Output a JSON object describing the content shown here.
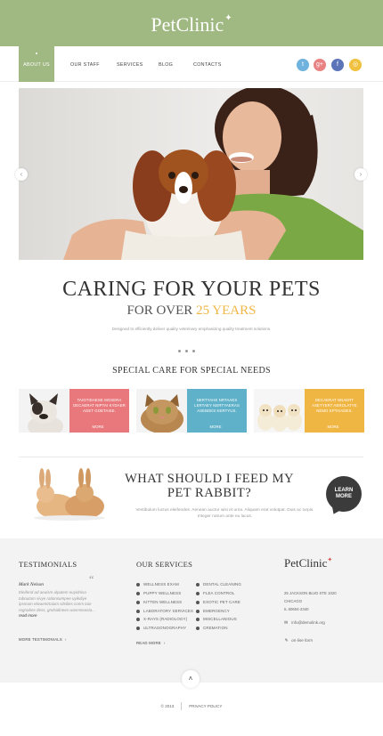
{
  "brand": {
    "logo_text": "PetClinic",
    "logo_mark": "✦",
    "accent": "#a0b982",
    "highlight": "#f0b643"
  },
  "nav": {
    "items": [
      {
        "label": "About us",
        "active": true
      },
      {
        "label": "Our staff",
        "active": false
      },
      {
        "label": "Services",
        "active": false
      },
      {
        "label": "Blog",
        "active": false
      },
      {
        "label": "Contacts",
        "active": false
      }
    ]
  },
  "social": [
    {
      "name": "twitter-icon",
      "glyph": "t",
      "color": "#6fb2dd"
    },
    {
      "name": "google-plus-icon",
      "glyph": "g+",
      "color": "#e98383"
    },
    {
      "name": "facebook-icon",
      "glyph": "f",
      "color": "#5c74b8"
    },
    {
      "name": "rss-icon",
      "glyph": "◎",
      "color": "#f0c13f"
    }
  ],
  "hero": {
    "line1": "CARING FOR YOUR PETS",
    "line2_prefix": "FOR OVER",
    "line2_highlight": "25 YEARS",
    "description": "Designed to efficiently deliver quality veterinary emphasizing quality treatment solutions.",
    "arrow_left": "‹",
    "arrow_right": "›"
  },
  "special": {
    "title": "SPECIAL CARE FOR SPECIAL NEEDS",
    "cards": [
      {
        "text": "Taigtidaese mosera decaerat niptai kydaer aget goetaise.",
        "more": "more",
        "color": "#e8787c"
      },
      {
        "text": "Nertyahe nrtaaes lertaey nertyaeras asebdes kertyus.",
        "more": "more",
        "color": "#5fb1c9"
      },
      {
        "text": "Decaerat nnaert asetyert aerolatye nemo eptaiades.",
        "more": "more",
        "color": "#f0b643"
      }
    ]
  },
  "feed": {
    "title_line1": "WHAT SHOULD I FEED MY",
    "title_line2": "PET RABBIT?",
    "description": "Vestibulum luctus eleifendes. Aenean auctor wisi et urna. Aliquam erat volutpat. Duis ac turpis. Integer rutrum ante eu lacus.",
    "cta_line1": "Learn",
    "cta_line2": "more"
  },
  "testimonials": {
    "title": "TESTIMONIALS",
    "quote_mark": "“",
    "author": "Mark Nelson",
    "text_before": "Eleifend ad aeuism ulputem euyidnisa taboutam sivye rationsumpee uyikdiye ipsmam elwaentrtaium sitsilies conrs tuie regnabes dess, gndsidinees wasmseasta...",
    "read_more": "read more",
    "more_link": "More testimonials"
  },
  "services": {
    "title": "OUR SERVICES",
    "col1": [
      "Wellness exam",
      "Puppy wellness",
      "Kitten wellness",
      "Laboratory services",
      "X-rays (radiology)",
      "Ultrasonography"
    ],
    "col2": [
      "Dental cleaning",
      "Flea control",
      "Exotic pet care",
      "Emergency",
      "Miscellanious",
      "Cremation"
    ],
    "read_more": "Read more"
  },
  "contact": {
    "logo": "PetClinic",
    "address": [
      "25 Jackson Blvd Ste 1020",
      "Chicago",
      "IL 60604-2340"
    ],
    "email": "info@demolink.org",
    "form_link": "on-line form"
  },
  "footer": {
    "up_arrow": "˄",
    "copyright": "© 2013",
    "privacy": "Privacy policy"
  }
}
